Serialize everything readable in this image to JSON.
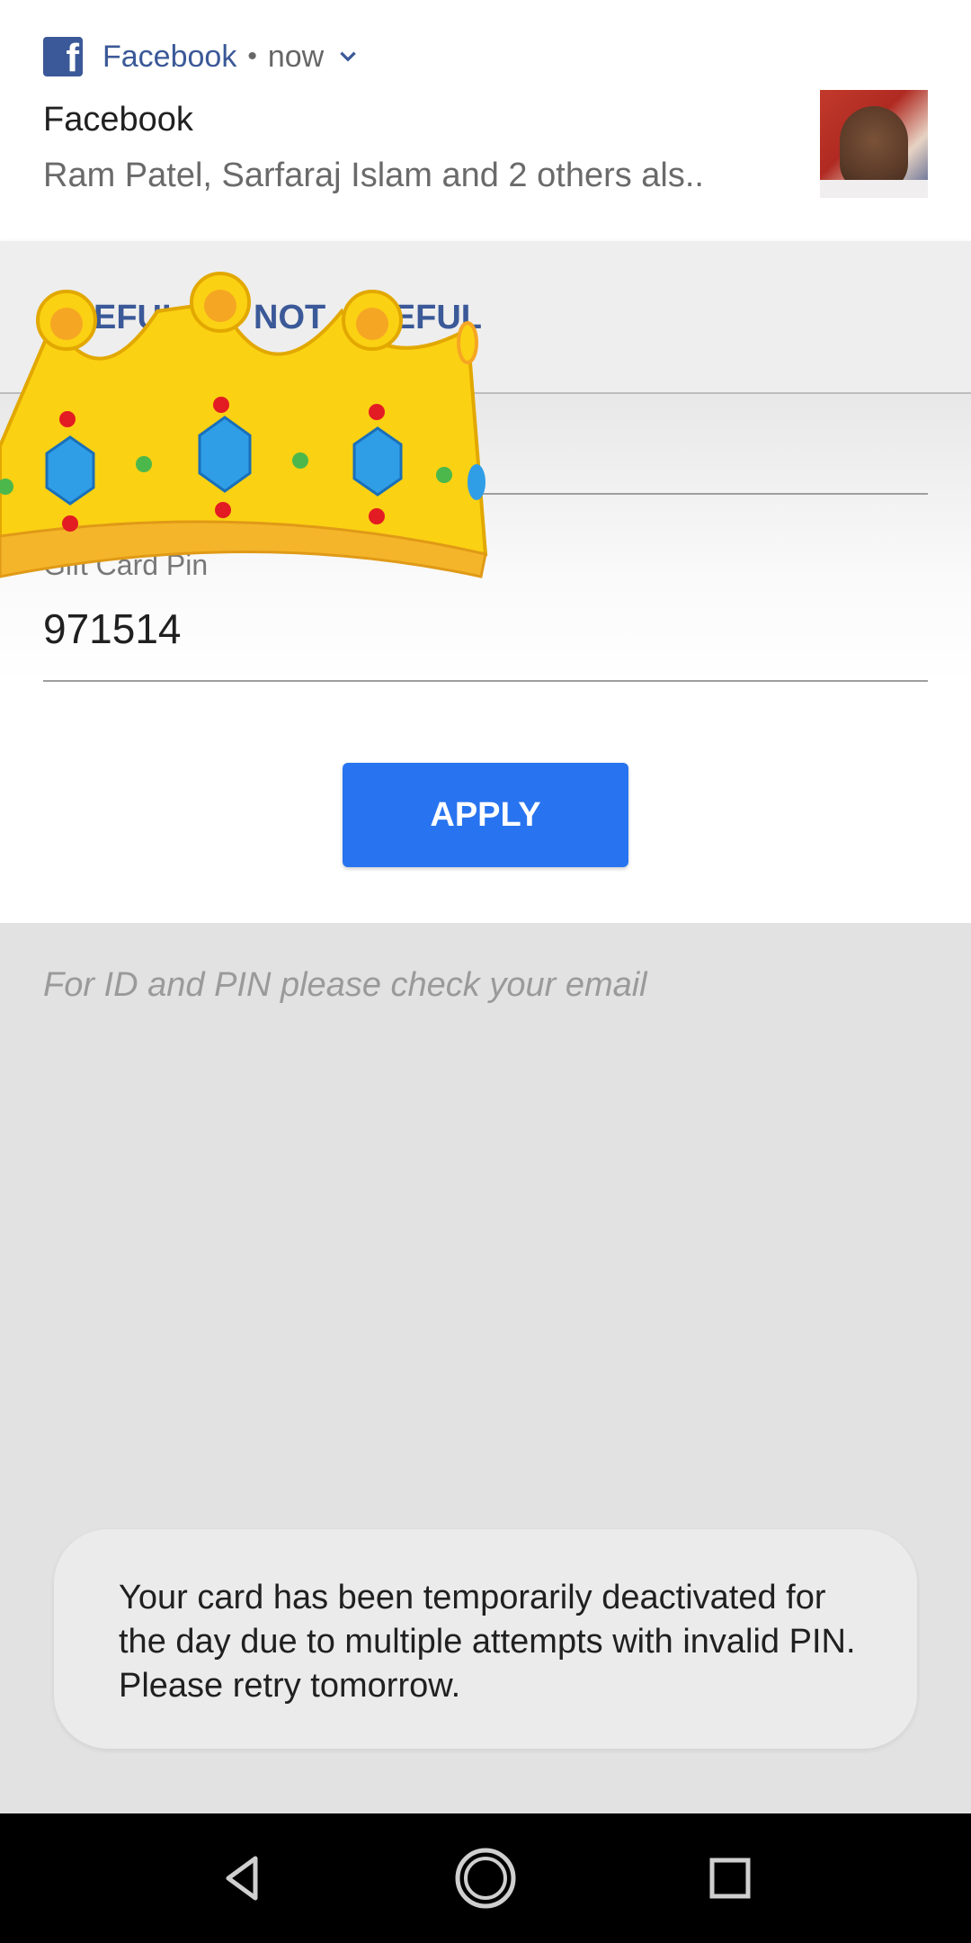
{
  "notification": {
    "app_icon": "facebook-logo",
    "app_name": "Facebook",
    "separator": "•",
    "time": "now",
    "title": "Facebook",
    "text": "Ram Patel, Sarfaraj Islam and 2 others als.."
  },
  "actions": {
    "useful_label": "USEFUL",
    "not_useful_label": "NOT USEFUL",
    "useful_visible": "EFUL",
    "not_useful_visible_left": "NOT ",
    "not_useful_visible_right": "EFUL"
  },
  "form": {
    "pin_label": "Gift Card Pin",
    "pin_value": "971514",
    "apply_label": "APPLY"
  },
  "hint": "For ID and PIN please check your email",
  "toast": {
    "message": "Your card has been temporarily deactivated for the day due to multiple attempts with invalid PIN. Please retry tomorrow."
  },
  "colors": {
    "accent": "#2874f0",
    "facebook_blue": "#3b5998"
  }
}
